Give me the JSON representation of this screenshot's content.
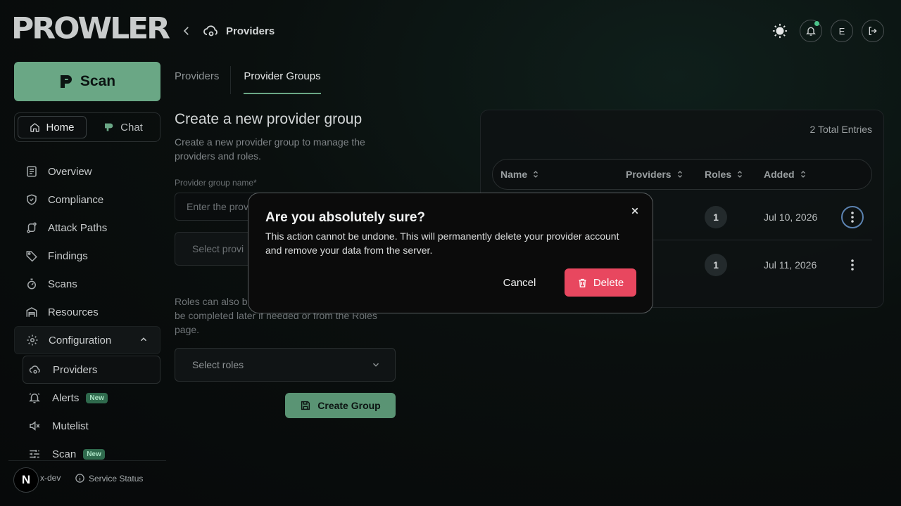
{
  "brand": {
    "logo_text": "PROWLER"
  },
  "sidebar": {
    "scan_label": "Scan",
    "segments": [
      {
        "label": "Home",
        "active": true
      },
      {
        "label": "Chat",
        "active": false
      }
    ],
    "items": [
      {
        "label": "Overview",
        "icon": "document-icon"
      },
      {
        "label": "Compliance",
        "icon": "shield-check-icon"
      },
      {
        "label": "Attack Paths",
        "icon": "route-icon"
      },
      {
        "label": "Findings",
        "icon": "tag-icon"
      },
      {
        "label": "Scans",
        "icon": "timer-icon"
      },
      {
        "label": "Resources",
        "icon": "warehouse-icon"
      }
    ],
    "configuration": {
      "label": "Configuration",
      "children": [
        {
          "label": "Providers",
          "active": true
        },
        {
          "label": "Alerts",
          "badge": "New"
        },
        {
          "label": "Mutelist"
        },
        {
          "label": "Scan",
          "badge": "New"
        }
      ]
    },
    "footer": {
      "avatar": "N",
      "org": "x-dev",
      "service_status": "Service Status"
    }
  },
  "header": {
    "breadcrumb": "Providers",
    "user_initial": "E"
  },
  "tabs": [
    {
      "label": "Providers",
      "active": false
    },
    {
      "label": "Provider Groups",
      "active": true
    }
  ],
  "form": {
    "title": "Create a new provider group",
    "description": "Create a new provider group to manage the providers and roles.",
    "name_label": "Provider group name*",
    "name_placeholder": "Enter the provi",
    "providers_placeholder": "Select provi",
    "roles_note": "Roles can also b                              This step is optional and can be completed later if needed or from the Roles page.",
    "roles_placeholder": "Select roles",
    "create_label": "Create Group"
  },
  "table": {
    "total": "2 Total Entries",
    "columns": [
      "Name",
      "Providers",
      "Roles",
      "Added"
    ],
    "rows": [
      {
        "roles": "1",
        "added": "Jul 10, 2026"
      },
      {
        "roles": "1",
        "added": "Jul 11, 2026"
      }
    ]
  },
  "modal": {
    "title": "Are you absolutely sure?",
    "body": "This action cannot be undone. This will permanently delete your provider account and remove your data from the server.",
    "cancel": "Cancel",
    "delete": "Delete"
  },
  "colors": {
    "accent": "#6aa785",
    "danger": "#e8475f",
    "focus_ring": "#5b82b0"
  }
}
